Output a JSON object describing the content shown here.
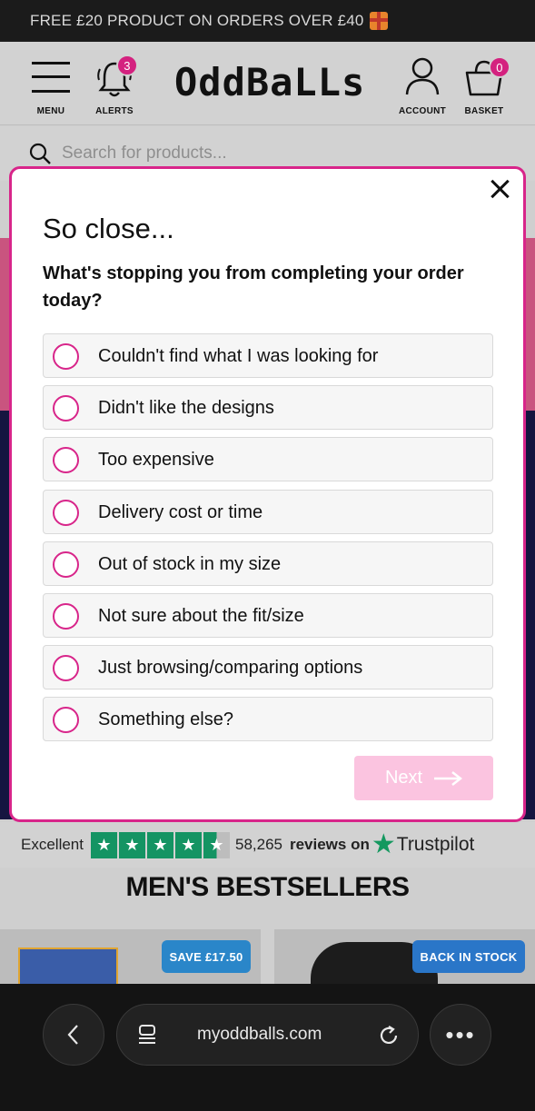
{
  "promo": {
    "text": "FREE £20 PRODUCT ON ORDERS OVER £40",
    "icon": "gift-icon"
  },
  "header": {
    "menu_label": "MENU",
    "alerts_label": "ALERTS",
    "alerts_count": "3",
    "logo": "OddBaLLs",
    "account_label": "ACCOUNT",
    "basket_label": "BASKET",
    "basket_count": "0"
  },
  "search": {
    "placeholder": "Search for products..."
  },
  "modal": {
    "title": "So close...",
    "question": "What's stopping you from completing your order today?",
    "options": [
      {
        "label": "Couldn't find what I was looking for"
      },
      {
        "label": "Didn't like the designs"
      },
      {
        "label": "Too expensive"
      },
      {
        "label": "Delivery cost or time"
      },
      {
        "label": "Out of stock in my size"
      },
      {
        "label": "Not sure about the fit/size"
      },
      {
        "label": "Just browsing/comparing options"
      },
      {
        "label": "Something else?"
      }
    ],
    "next_label": "Next"
  },
  "trustpilot": {
    "rating_text": "Excellent",
    "count": "58,265",
    "reviews_on": "reviews on",
    "brand": "Trustpilot",
    "stars": 4.5
  },
  "section": {
    "title": "MEN'S BESTSELLERS"
  },
  "products": [
    {
      "tag": "SAVE £17.50"
    },
    {
      "tag": "BACK IN STOCK"
    }
  ],
  "browser": {
    "url": "myoddballs.com"
  },
  "colors": {
    "accent": "#d8258a",
    "next_disabled": "#fbc4e0",
    "trustpilot_green": "#149463"
  }
}
